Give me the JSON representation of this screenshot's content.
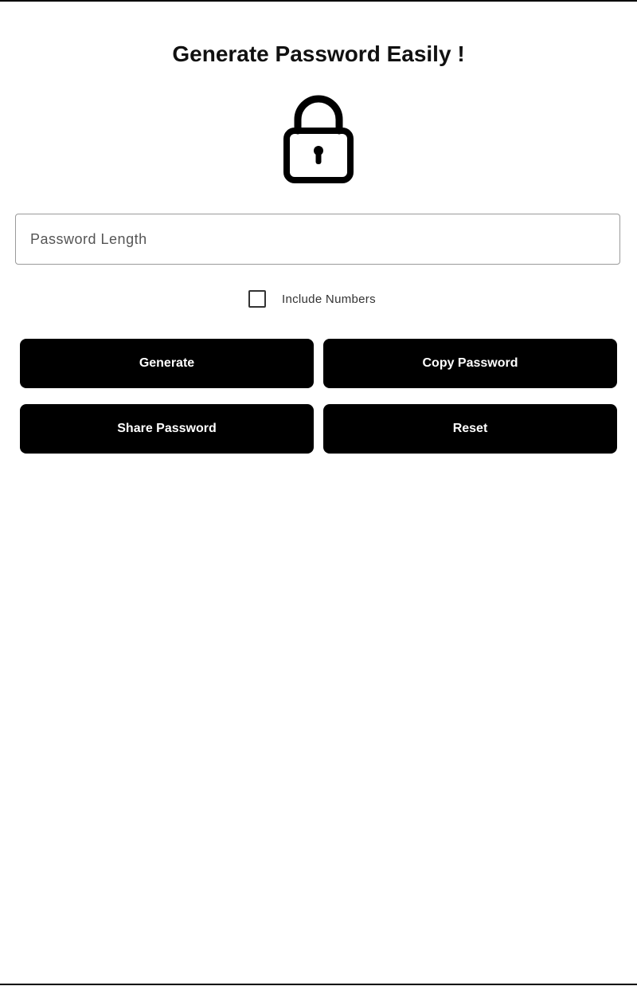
{
  "title": "Generate Password Easily !",
  "icon": "lock-icon",
  "password_length": {
    "placeholder": "Password Length",
    "value": ""
  },
  "include_numbers": {
    "label": "Include Numbers",
    "checked": false
  },
  "buttons": {
    "generate": "Generate",
    "copy": "Copy Password",
    "share": "Share Password",
    "reset": "Reset"
  },
  "colors": {
    "button_bg": "#000000",
    "button_text": "#ffffff",
    "background": "#ffffff"
  }
}
